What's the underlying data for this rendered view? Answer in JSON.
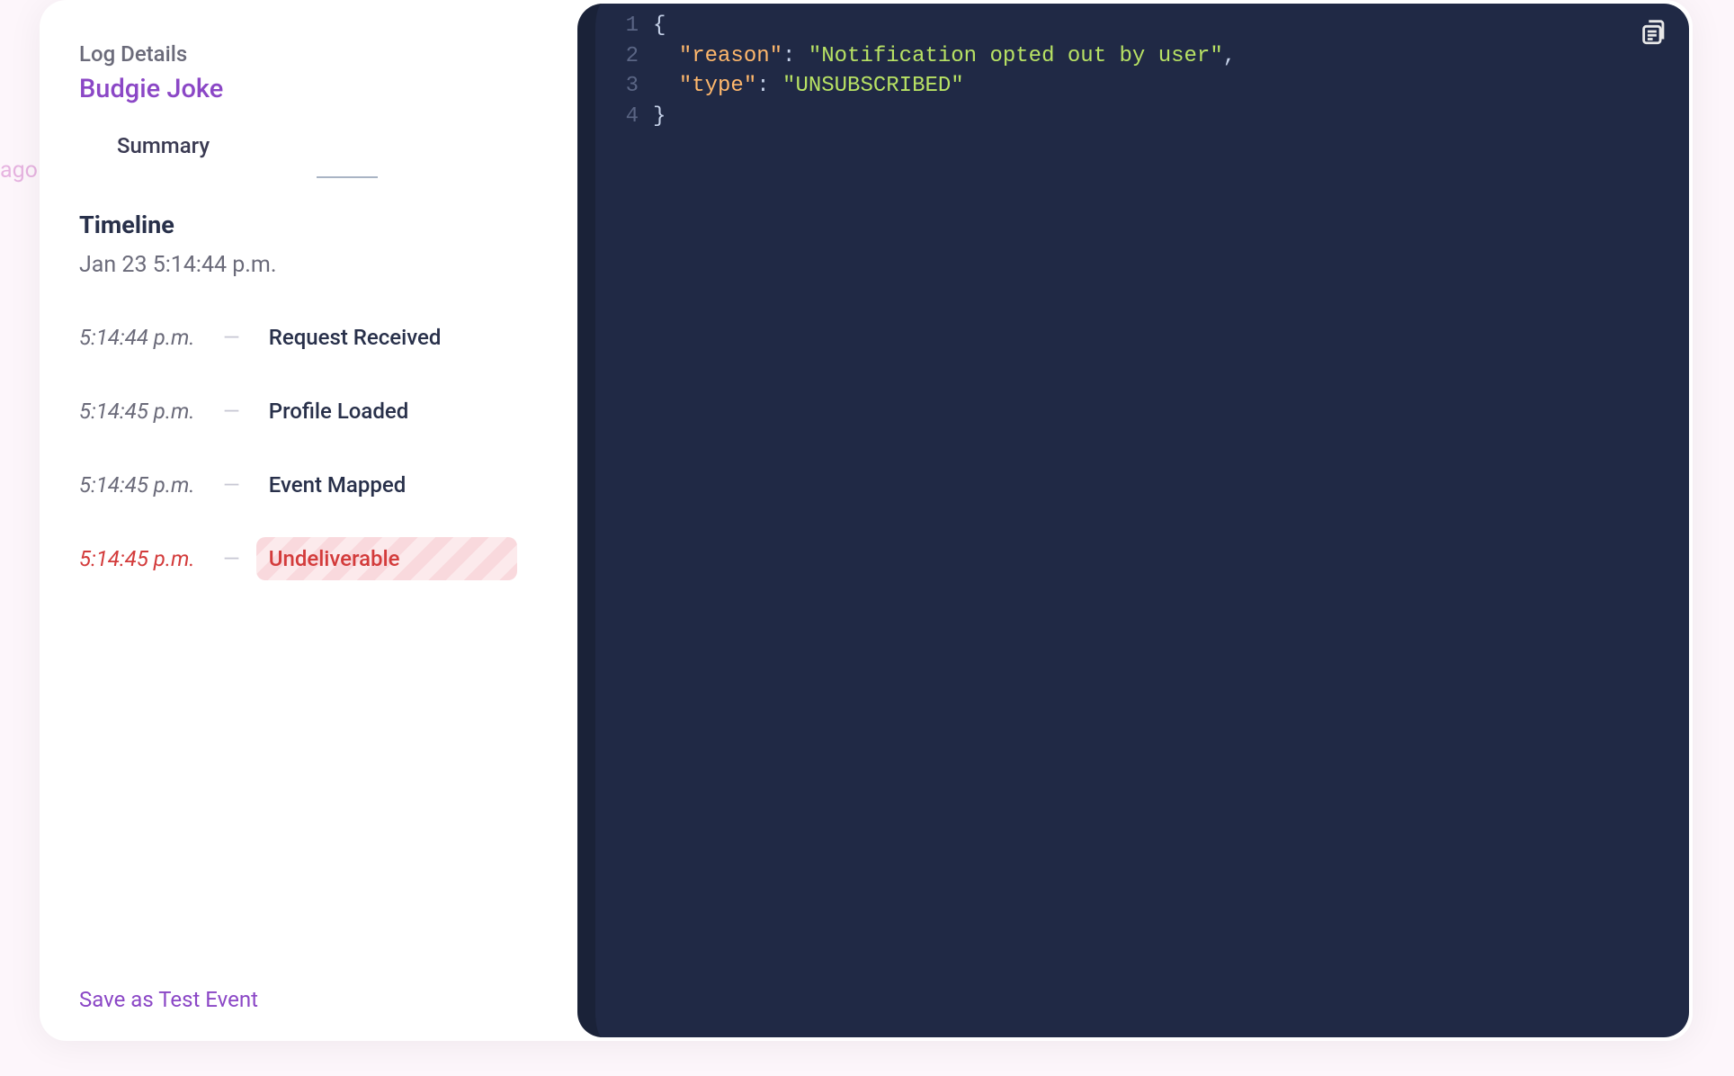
{
  "background": {
    "partial_text": "ago"
  },
  "left": {
    "details_label": "Log Details",
    "event_title": "Budgie Joke",
    "tabs": {
      "summary": "Summary"
    },
    "timeline": {
      "heading": "Timeline",
      "date": "Jan 23 5:14:44 p.m.",
      "rows": [
        {
          "time": "5:14:44 p.m.",
          "label": "Request Received",
          "error": false
        },
        {
          "time": "5:14:45 p.m.",
          "label": "Profile Loaded",
          "error": false
        },
        {
          "time": "5:14:45 p.m.",
          "label": "Event Mapped",
          "error": false
        },
        {
          "time": "5:14:45 p.m.",
          "label": "Undeliverable",
          "error": true
        }
      ]
    },
    "save_link": "Save as Test Event"
  },
  "json": {
    "lines": [
      {
        "num": "1",
        "tokens": [
          {
            "t": "{",
            "c": "brace"
          }
        ]
      },
      {
        "num": "2",
        "tokens": [
          {
            "t": "  ",
            "c": "plain"
          },
          {
            "t": "\"reason\"",
            "c": "key"
          },
          {
            "t": ": ",
            "c": "punct"
          },
          {
            "t": "\"Notification opted out by user\"",
            "c": "str"
          },
          {
            "t": ",",
            "c": "punct"
          }
        ]
      },
      {
        "num": "3",
        "tokens": [
          {
            "t": "  ",
            "c": "plain"
          },
          {
            "t": "\"type\"",
            "c": "key"
          },
          {
            "t": ": ",
            "c": "punct"
          },
          {
            "t": "\"UNSUBSCRIBED\"",
            "c": "str"
          }
        ]
      },
      {
        "num": "4",
        "tokens": [
          {
            "t": "}",
            "c": "brace"
          }
        ]
      }
    ]
  }
}
